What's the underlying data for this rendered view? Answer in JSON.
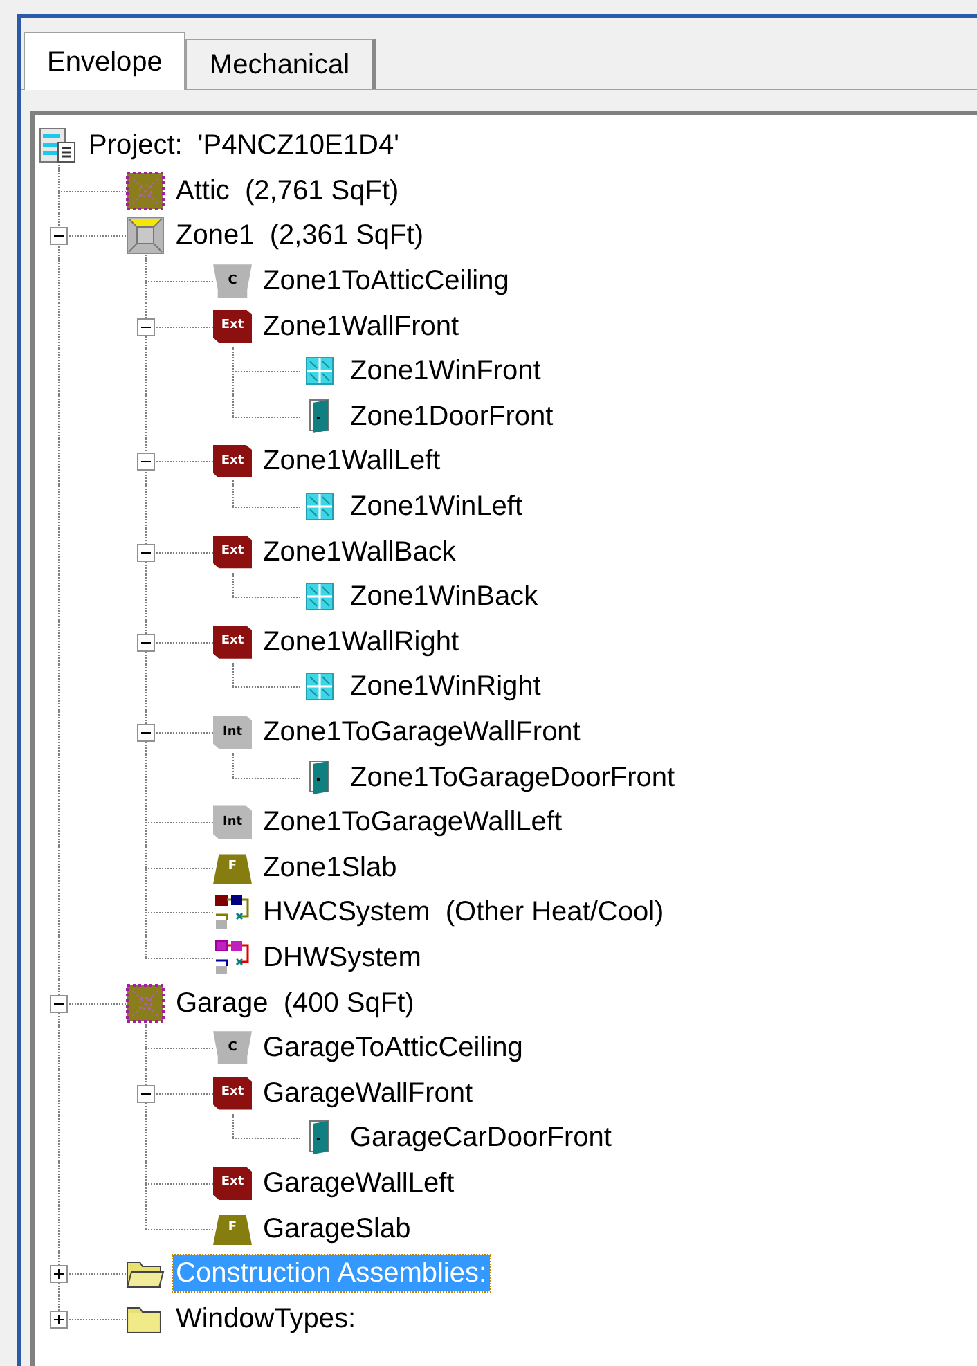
{
  "tabs": [
    {
      "label": "Envelope",
      "selected": true
    },
    {
      "label": "Mechanical",
      "selected": false
    }
  ],
  "tree": {
    "label": "Project:  'P4NCZ10E1D4'",
    "kind": "project",
    "selected": false,
    "children": [
      {
        "label": "Attic  (2,761 SqFt)",
        "kind": "attic",
        "selected": false
      },
      {
        "label": "Zone1  (2,361 SqFt)",
        "kind": "zone",
        "selected": false,
        "expanded": true,
        "children": [
          {
            "label": "Zone1ToAtticCeiling",
            "kind": "ceiling",
            "icon_label": "C",
            "selected": false
          },
          {
            "label": "Zone1WallFront",
            "kind": "ext-wall",
            "icon_label": "Ext",
            "selected": false,
            "expanded": true,
            "children": [
              {
                "label": "Zone1WinFront",
                "kind": "window",
                "selected": false
              },
              {
                "label": "Zone1DoorFront",
                "kind": "door",
                "selected": false
              }
            ]
          },
          {
            "label": "Zone1WallLeft",
            "kind": "ext-wall",
            "icon_label": "Ext",
            "selected": false,
            "expanded": true,
            "children": [
              {
                "label": "Zone1WinLeft",
                "kind": "window",
                "selected": false
              }
            ]
          },
          {
            "label": "Zone1WallBack",
            "kind": "ext-wall",
            "icon_label": "Ext",
            "selected": false,
            "expanded": true,
            "children": [
              {
                "label": "Zone1WinBack",
                "kind": "window",
                "selected": false
              }
            ]
          },
          {
            "label": "Zone1WallRight",
            "kind": "ext-wall",
            "icon_label": "Ext",
            "selected": false,
            "expanded": true,
            "children": [
              {
                "label": "Zone1WinRight",
                "kind": "window",
                "selected": false
              }
            ]
          },
          {
            "label": "Zone1ToGarageWallFront",
            "kind": "int-wall",
            "icon_label": "Int",
            "selected": false,
            "expanded": true,
            "children": [
              {
                "label": "Zone1ToGarageDoorFront",
                "kind": "door",
                "selected": false
              }
            ]
          },
          {
            "label": "Zone1ToGarageWallLeft",
            "kind": "int-wall",
            "icon_label": "Int",
            "selected": false
          },
          {
            "label": "Zone1Slab",
            "kind": "slab",
            "icon_label": "F",
            "selected": false
          },
          {
            "label": "HVACSystem  (Other Heat/Cool)",
            "kind": "hvac",
            "selected": false
          },
          {
            "label": "DHWSystem",
            "kind": "dhw",
            "selected": false
          }
        ]
      },
      {
        "label": "Garage  (400 SqFt)",
        "kind": "attic",
        "selected": false,
        "expanded": true,
        "children": [
          {
            "label": "GarageToAtticCeiling",
            "kind": "ceiling",
            "icon_label": "C",
            "selected": false
          },
          {
            "label": "GarageWallFront",
            "kind": "ext-wall",
            "icon_label": "Ext",
            "selected": false,
            "expanded": true,
            "children": [
              {
                "label": "GarageCarDoorFront",
                "kind": "door",
                "selected": false
              }
            ]
          },
          {
            "label": "GarageWallLeft",
            "kind": "ext-wall",
            "icon_label": "Ext",
            "selected": false
          },
          {
            "label": "GarageSlab",
            "kind": "slab",
            "icon_label": "F",
            "selected": false
          }
        ]
      },
      {
        "label": "Construction Assemblies:",
        "kind": "folder-open",
        "selected": true,
        "expanded": false
      },
      {
        "label": "WindowTypes:",
        "kind": "folder",
        "selected": false,
        "expanded": false
      }
    ]
  }
}
